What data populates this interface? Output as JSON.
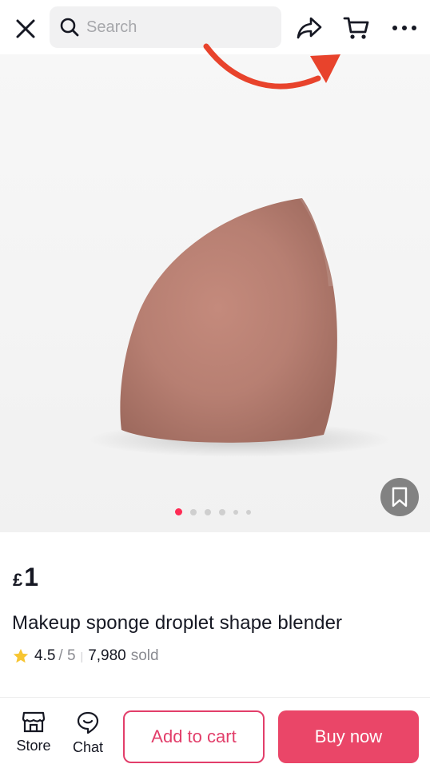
{
  "header": {
    "search_placeholder": "Search",
    "icons": [
      "close-icon",
      "search-icon",
      "share-icon",
      "cart-icon",
      "more-icon"
    ]
  },
  "gallery": {
    "image_count": 6,
    "active_index": 0,
    "colors": {
      "active_dot": "#fe2c55",
      "inactive_dot": "#cfcfcf"
    }
  },
  "product": {
    "currency": "£",
    "price": "1",
    "title": "Makeup sponge droplet shape blender",
    "rating": "4.5",
    "rating_outof": "/ 5",
    "sold_count": "7,980",
    "sold_label": "sold"
  },
  "bottom_bar": {
    "store_label": "Store",
    "chat_label": "Chat",
    "add_to_cart_label": "Add to cart",
    "buy_now_label": "Buy now",
    "colors": {
      "accent": "#ea4668",
      "outline": "#e23e6a"
    }
  },
  "annotation": {
    "arrow_color": "#e8432c"
  }
}
